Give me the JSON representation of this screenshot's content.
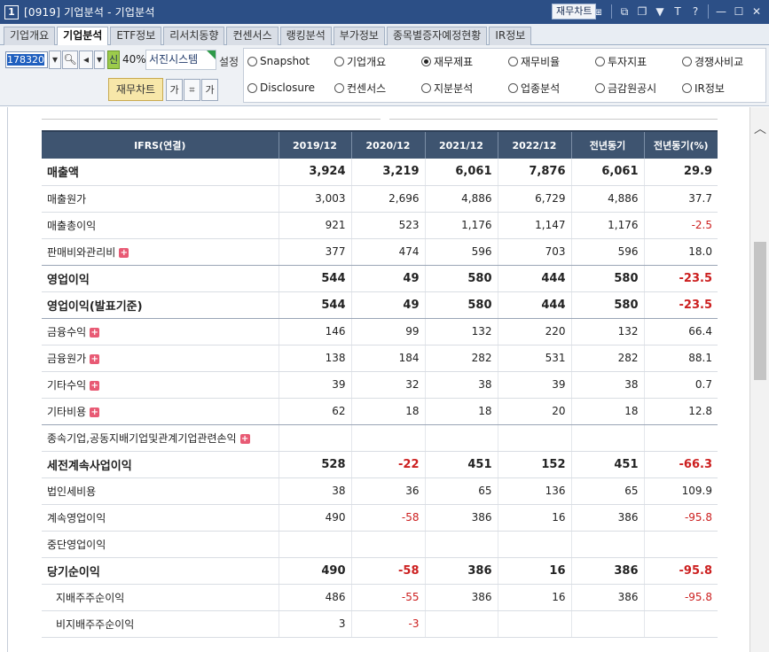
{
  "window": {
    "number": "1",
    "title": "[0919] 기업분석 - 기업분석",
    "chart_button": "재무차트",
    "icons": [
      "chart-line-icon",
      "window-split-icon",
      "window-restore-icon",
      "pin-icon",
      "font-size-icon",
      "help-icon",
      "minimize-icon",
      "maximize-icon",
      "close-icon"
    ],
    "icon_glyphs": [
      "⧆",
      "⧉",
      "❐",
      "▼",
      "T",
      "?",
      "—",
      "☐",
      "✕"
    ]
  },
  "tabs": [
    {
      "label": "기업개요",
      "active": false
    },
    {
      "label": "기업분석",
      "active": true
    },
    {
      "label": "ETF정보",
      "active": false
    },
    {
      "label": "리서치동향",
      "active": false
    },
    {
      "label": "컨센서스",
      "active": false
    },
    {
      "label": "랭킹분석",
      "active": false
    },
    {
      "label": "부가정보",
      "active": false
    },
    {
      "label": "종목별증자예정현황",
      "active": false
    },
    {
      "label": "IR정보",
      "active": false
    }
  ],
  "toolbar": {
    "stock_code": "178320",
    "shin_label": "신",
    "margin_pct": "40%",
    "company_name": "서진시스템",
    "setting_label": "설정",
    "fin_chart_button": "재무차트",
    "small_buttons": [
      "가",
      "⌗",
      "가"
    ]
  },
  "radios": [
    {
      "label": "Snapshot",
      "checked": false
    },
    {
      "label": "기업개요",
      "checked": false
    },
    {
      "label": "재무제표",
      "checked": true
    },
    {
      "label": "재무비율",
      "checked": false
    },
    {
      "label": "투자지표",
      "checked": false
    },
    {
      "label": "경쟁사비교",
      "checked": false
    },
    {
      "label": "Disclosure",
      "checked": false
    },
    {
      "label": "컨센서스",
      "checked": false
    },
    {
      "label": "지분분석",
      "checked": false
    },
    {
      "label": "업종분석",
      "checked": false
    },
    {
      "label": "금감원공시",
      "checked": false
    },
    {
      "label": "IR정보",
      "checked": false
    }
  ],
  "table": {
    "headers": [
      "IFRS(연결)",
      "2019/12",
      "2020/12",
      "2021/12",
      "2022/12",
      "전년동기",
      "전년동기(%)"
    ],
    "rows": [
      {
        "label": "매출액",
        "bold": true,
        "plus": false,
        "indent": false,
        "values": [
          "3,924",
          "3,219",
          "6,061",
          "7,876",
          "6,061",
          "29.9"
        ]
      },
      {
        "label": "매출원가",
        "bold": false,
        "plus": false,
        "indent": false,
        "values": [
          "3,003",
          "2,696",
          "4,886",
          "6,729",
          "4,886",
          "37.7"
        ]
      },
      {
        "label": "매출총이익",
        "bold": false,
        "plus": false,
        "indent": false,
        "values": [
          "921",
          "523",
          "1,176",
          "1,147",
          "1,176",
          "-2.5"
        ]
      },
      {
        "label": "판매비와관리비",
        "bold": false,
        "plus": true,
        "indent": false,
        "values": [
          "377",
          "474",
          "596",
          "703",
          "596",
          "18.0"
        ]
      },
      {
        "label": "영업이익",
        "bold": true,
        "plus": false,
        "indent": false,
        "values": [
          "544",
          "49",
          "580",
          "444",
          "580",
          "-23.5"
        ]
      },
      {
        "label": "영업이익(발표기준)",
        "bold": true,
        "plus": false,
        "indent": false,
        "values": [
          "544",
          "49",
          "580",
          "444",
          "580",
          "-23.5"
        ]
      },
      {
        "label": "금융수익",
        "bold": false,
        "plus": true,
        "indent": false,
        "values": [
          "146",
          "99",
          "132",
          "220",
          "132",
          "66.4"
        ]
      },
      {
        "label": "금융원가",
        "bold": false,
        "plus": true,
        "indent": false,
        "values": [
          "138",
          "184",
          "282",
          "531",
          "282",
          "88.1"
        ]
      },
      {
        "label": "기타수익",
        "bold": false,
        "plus": true,
        "indent": false,
        "values": [
          "39",
          "32",
          "38",
          "39",
          "38",
          "0.7"
        ]
      },
      {
        "label": "기타비용",
        "bold": false,
        "plus": true,
        "indent": false,
        "values": [
          "62",
          "18",
          "18",
          "20",
          "18",
          "12.8"
        ]
      },
      {
        "label": "종속기업,공동지배기업및관계기업관련손익",
        "bold": false,
        "plus": true,
        "indent": false,
        "values": [
          "",
          "",
          "",
          "",
          "",
          ""
        ]
      },
      {
        "label": "세전계속사업이익",
        "bold": true,
        "plus": false,
        "indent": false,
        "values": [
          "528",
          "-22",
          "451",
          "152",
          "451",
          "-66.3"
        ]
      },
      {
        "label": "법인세비용",
        "bold": false,
        "plus": false,
        "indent": false,
        "values": [
          "38",
          "36",
          "65",
          "136",
          "65",
          "109.9"
        ]
      },
      {
        "label": "계속영업이익",
        "bold": false,
        "plus": false,
        "indent": false,
        "values": [
          "490",
          "-58",
          "386",
          "16",
          "386",
          "-95.8"
        ]
      },
      {
        "label": "중단영업이익",
        "bold": false,
        "plus": false,
        "indent": false,
        "values": [
          "",
          "",
          "",
          "",
          "",
          ""
        ]
      },
      {
        "label": "당기순이익",
        "bold": true,
        "plus": false,
        "indent": false,
        "values": [
          "490",
          "-58",
          "386",
          "16",
          "386",
          "-95.8"
        ]
      },
      {
        "label": "지배주주순이익",
        "bold": false,
        "plus": false,
        "indent": true,
        "values": [
          "486",
          "-55",
          "386",
          "16",
          "386",
          "-95.8"
        ]
      },
      {
        "label": "비지배주주순이익",
        "bold": false,
        "plus": false,
        "indent": true,
        "values": [
          "3",
          "-3",
          "",
          "",
          "",
          ""
        ]
      }
    ]
  }
}
